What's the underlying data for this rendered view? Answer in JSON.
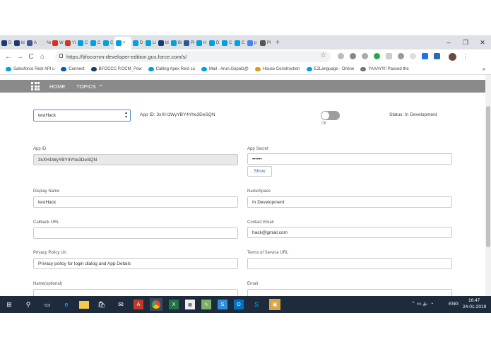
{
  "browser": {
    "tabs": [
      {
        "label": "D",
        "color": "#1b3b6f"
      },
      {
        "label": "bl",
        "color": "#1b3b6f"
      },
      {
        "label": "A",
        "color": "#3b5998"
      },
      {
        "label": "New S",
        "color": "#dddddd"
      },
      {
        "label": "W",
        "color": "#d93025"
      },
      {
        "label": "Yi",
        "color": "#d93025"
      },
      {
        "label": "C",
        "color": "#00a1e0"
      },
      {
        "label": "C",
        "color": "#00a1e0"
      },
      {
        "label": "C",
        "color": "#00a1e0"
      },
      {
        "label": "×",
        "color": "#00a1e0"
      },
      {
        "label": "D",
        "color": "#00a1e0"
      },
      {
        "label": "Li",
        "color": "#00a1e0"
      },
      {
        "label": "bl",
        "color": "#1b3b6f"
      },
      {
        "label": "Bi",
        "color": "#00a1e0"
      },
      {
        "label": "Pi",
        "color": "#2b579a"
      },
      {
        "label": "H",
        "color": "#00a1e0"
      },
      {
        "label": "D",
        "color": "#00a1e0"
      },
      {
        "label": "C",
        "color": "#00a1e0"
      },
      {
        "label": "C",
        "color": "#00a1e0"
      },
      {
        "label": "p",
        "color": "#4285f4"
      },
      {
        "label": "Pi",
        "color": "#555555"
      }
    ],
    "new_tab": "+",
    "window_controls": [
      "–",
      "❐",
      "✕"
    ],
    "nav": {
      "back": "←",
      "forward": "→",
      "reload": "C",
      "home": "⌂"
    },
    "url": "https://bfocomm-developer-edition.gus.force.com/s/",
    "star": "☆",
    "bookmarks": [
      {
        "label": "Salesforce Rest API u"
      },
      {
        "label": "Connect"
      },
      {
        "label": "BFOCCC P.OCM_Pow"
      },
      {
        "label": "Calling Apex Rest cu"
      },
      {
        "label": "Mail - Arun.Gopal1@"
      },
      {
        "label": "House Construction"
      },
      {
        "label": "E2Language - Online"
      },
      {
        "label": "YAAAY!!!! Passed the"
      }
    ],
    "more": "»"
  },
  "site_nav": {
    "menu_icon": "grid-icon",
    "home": "HOME",
    "topics": "TOPICS",
    "topics_chevron": "⌄"
  },
  "app_header": {
    "select_value": "testHack",
    "app_id_label": "App ID: 3xXH1WyYBY4Yhe3DeSQN",
    "toggle_state": "Off",
    "status": "Status: In Development"
  },
  "form": {
    "app_id": {
      "label": "App ID",
      "value": "3xXH1WyYBY4Yhe3DeSQN"
    },
    "app_secret": {
      "label": "App Secret",
      "value": "••••••",
      "show_button": "Show"
    },
    "display_name": {
      "label": "Display Name",
      "value": "testHack"
    },
    "namespace": {
      "label": "NameSpace",
      "value": "In Development"
    },
    "callback_url": {
      "label": "Callback URL",
      "value": ""
    },
    "contact_email": {
      "label": "Contact Email",
      "value": "hack@gmail.com"
    },
    "privacy_policy": {
      "label": "Privacy Policy Url",
      "value": "Privacy policy for login dialog and App Details"
    },
    "terms_url": {
      "label": "Terms of Service URL",
      "value": ""
    },
    "name_optional": {
      "label": "Name(optional)",
      "value": ""
    },
    "email": {
      "label": "Email",
      "value": ""
    }
  },
  "taskbar": {
    "time": "16:47",
    "date": "24-01-2019",
    "lang": "ENG",
    "tray": "⌃ ▭ 🔈 ◔"
  }
}
